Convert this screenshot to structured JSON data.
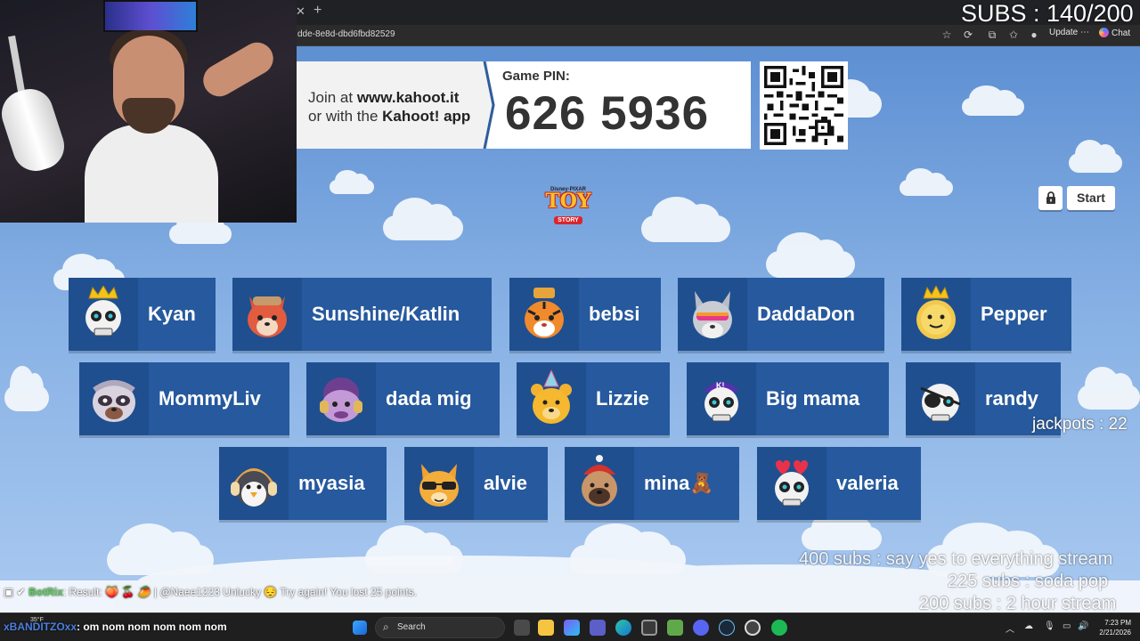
{
  "browser": {
    "url": "dde-8e8d-dbd6fbd82529",
    "update_label": "Update",
    "chat_label": "Chat"
  },
  "overlay": {
    "subs": "SUBS : 140/200",
    "jackpots": "jackpots : 22",
    "goal_400": "400 subs :  say yes to everything stream",
    "goal_225": "225 subs :  soda pop",
    "goal_200": "200 subs : 2 hour stream"
  },
  "kahoot": {
    "join_prefix": "Join at ",
    "join_url": "www.kahoot.it",
    "join_or": "or with the ",
    "join_app": "Kahoot! app",
    "pin_label": "Game PIN:",
    "pin": "626 5936",
    "logo_top": "Disney·PIXAR",
    "logo_main": "TOY",
    "logo_sub": "STORY",
    "start_label": "Start"
  },
  "players": [
    {
      "name": "Kyan",
      "avatar": "skull-crown-icon"
    },
    {
      "name": "Sunshine/Katlin",
      "avatar": "fox-icon"
    },
    {
      "name": "bebsi",
      "avatar": "tiger-icon"
    },
    {
      "name": "DaddaDon",
      "avatar": "wolf-icon"
    },
    {
      "name": "Pepper",
      "avatar": "sun-crown-icon"
    },
    {
      "name": "MommyLiv",
      "avatar": "raccoon-icon"
    },
    {
      "name": "dada mig",
      "avatar": "purple-monster-icon"
    },
    {
      "name": "Lizzie",
      "avatar": "bear-party-icon"
    },
    {
      "name": "Big mama",
      "avatar": "skull-cap-icon"
    },
    {
      "name": "randy",
      "avatar": "skull-eyepatch-icon"
    },
    {
      "name": "myasia",
      "avatar": "penguin-icon"
    },
    {
      "name": "alvie",
      "avatar": "cat-sunglasses-icon"
    },
    {
      "name": "mina🧸",
      "avatar": "pug-icon"
    },
    {
      "name": "valeria",
      "avatar": "skull-hearts-icon"
    }
  ],
  "chat": {
    "bot_name": "BotRix",
    "bot_msg": ": Result: 🍑 🍒 🥭 | @Naee1223 Unlucky 😔 Try again! You lost 25 points.",
    "user_name": "xBANDITZOxx",
    "user_msg": ": om nom nom nom nom nom"
  },
  "taskbar": {
    "weather": "35°F",
    "search_label": "Search",
    "time": "7:23 PM",
    "date": "2/21/2026"
  }
}
